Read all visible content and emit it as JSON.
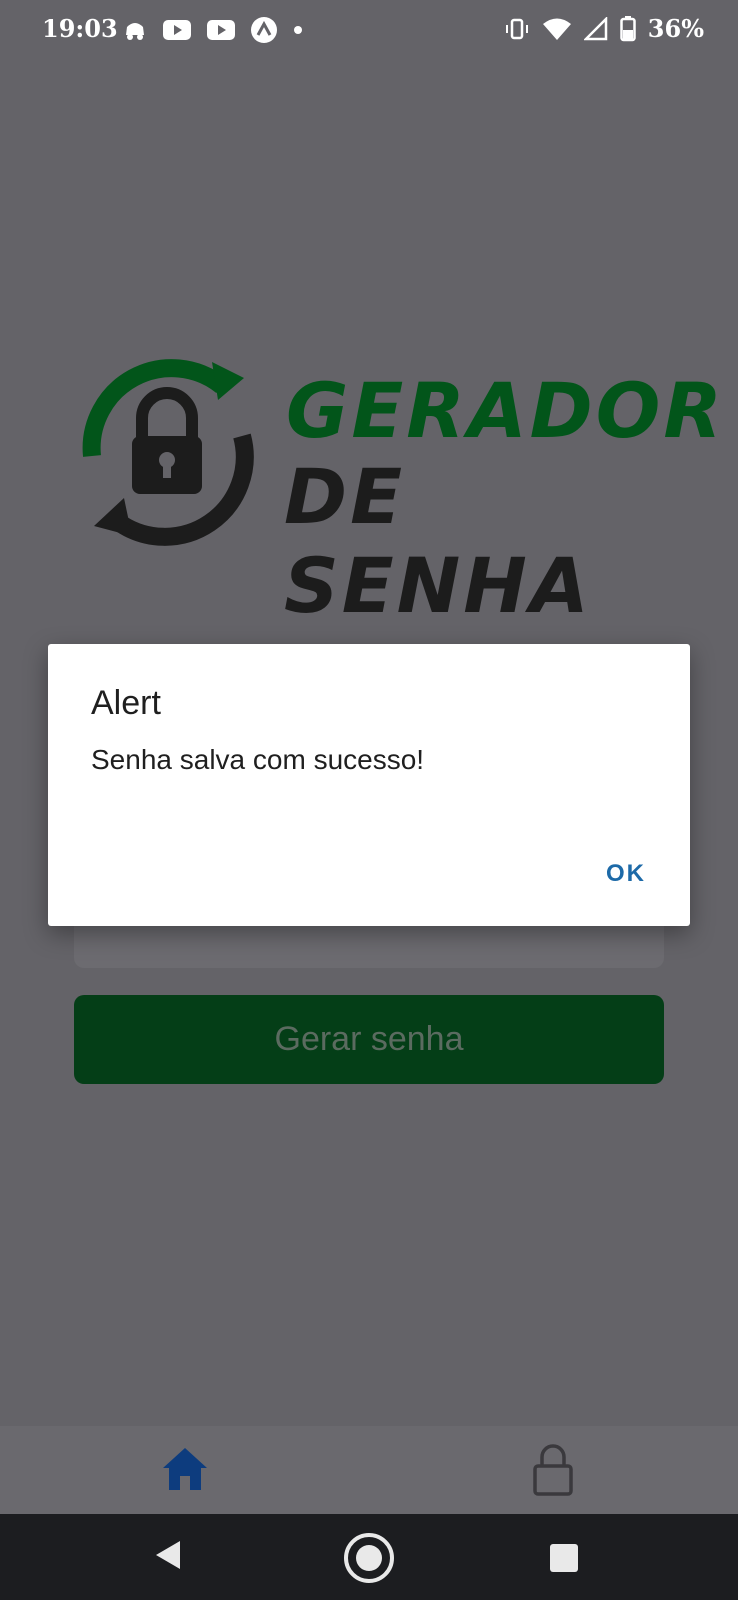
{
  "status_bar": {
    "time": "19:03",
    "battery_percent": "36%",
    "icons_left": [
      "notification-icon",
      "youtube-icon",
      "youtube-icon",
      "app-icon",
      "dot-icon"
    ],
    "icons_right": [
      "vibrate-icon",
      "wifi-icon",
      "signal-icon",
      "battery-icon"
    ]
  },
  "logo": {
    "line1": "GERADOR",
    "line2": "DE SENHA",
    "colors": {
      "green": "#02551a",
      "dark": "#1c1c1c"
    }
  },
  "main": {
    "generate_button_label": "Gerar senha"
  },
  "dialog": {
    "title": "Alert",
    "message": "Senha salva com sucesso!",
    "ok_label": "OK",
    "accent_color": "#1d6aa8"
  },
  "bottom_tabs": {
    "items": [
      {
        "icon": "home-icon",
        "active": true
      },
      {
        "icon": "lock-icon",
        "active": false
      }
    ],
    "active_color": "#0d3c7e"
  },
  "system_nav": {
    "buttons": [
      "back-icon",
      "home-circle-icon",
      "recents-icon"
    ]
  }
}
